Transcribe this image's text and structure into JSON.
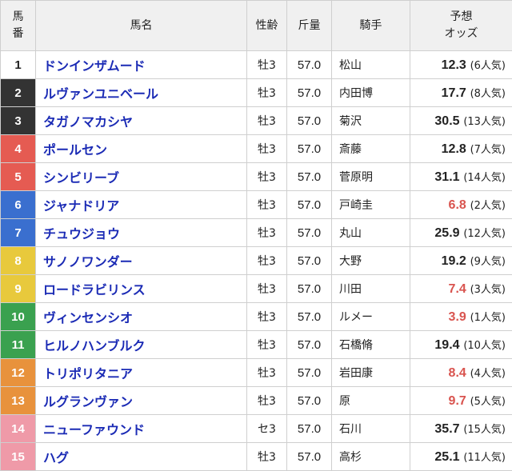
{
  "colors": {
    "header_bg": "#f0f0f0",
    "name_text": "#1b2bb5",
    "favorite_odds": "#d9544f"
  },
  "header": {
    "number": "馬\n番",
    "name": "馬名",
    "sex_age": "性齢",
    "weight": "斤量",
    "jockey": "騎手",
    "odds": "予想\nオッズ"
  },
  "rows": [
    {
      "num": "1",
      "name": "ドンインザムード",
      "sex_age": "牡3",
      "weight": "57.0",
      "jockey": "松山",
      "odds": "12.3",
      "pop": "(6人気)",
      "fav": false,
      "bg": "#ffffff",
      "fg": "#222222"
    },
    {
      "num": "2",
      "name": "ルヴァンユニベール",
      "sex_age": "牡3",
      "weight": "57.0",
      "jockey": "内田博",
      "odds": "17.7",
      "pop": "(8人気)",
      "fav": false,
      "bg": "#333333",
      "fg": "#ffffff"
    },
    {
      "num": "3",
      "name": "タガノマカシヤ",
      "sex_age": "牡3",
      "weight": "57.0",
      "jockey": "菊沢",
      "odds": "30.5",
      "pop": "(13人気)",
      "fav": false,
      "bg": "#333333",
      "fg": "#ffffff"
    },
    {
      "num": "4",
      "name": "ポールセン",
      "sex_age": "牡3",
      "weight": "57.0",
      "jockey": "斎藤",
      "odds": "12.8",
      "pop": "(7人気)",
      "fav": false,
      "bg": "#e55b52",
      "fg": "#ffffff"
    },
    {
      "num": "5",
      "name": "シンビリーブ",
      "sex_age": "牡3",
      "weight": "57.0",
      "jockey": "菅原明",
      "odds": "31.1",
      "pop": "(14人気)",
      "fav": false,
      "bg": "#e55b52",
      "fg": "#ffffff"
    },
    {
      "num": "6",
      "name": "ジャナドリア",
      "sex_age": "牡3",
      "weight": "57.0",
      "jockey": "戸崎圭",
      "odds": "6.8",
      "pop": "(2人気)",
      "fav": true,
      "bg": "#3a6fcf",
      "fg": "#ffffff"
    },
    {
      "num": "7",
      "name": "チュウジョウ",
      "sex_age": "牡3",
      "weight": "57.0",
      "jockey": "丸山",
      "odds": "25.9",
      "pop": "(12人気)",
      "fav": false,
      "bg": "#3a6fcf",
      "fg": "#ffffff"
    },
    {
      "num": "8",
      "name": "サノノワンダー",
      "sex_age": "牡3",
      "weight": "57.0",
      "jockey": "大野",
      "odds": "19.2",
      "pop": "(9人気)",
      "fav": false,
      "bg": "#e8c93c",
      "fg": "#ffffff"
    },
    {
      "num": "9",
      "name": "ロードラビリンス",
      "sex_age": "牡3",
      "weight": "57.0",
      "jockey": "川田",
      "odds": "7.4",
      "pop": "(3人気)",
      "fav": true,
      "bg": "#e8c93c",
      "fg": "#ffffff"
    },
    {
      "num": "10",
      "name": "ヴィンセンシオ",
      "sex_age": "牡3",
      "weight": "57.0",
      "jockey": "ルメー",
      "odds": "3.9",
      "pop": "(1人気)",
      "fav": true,
      "bg": "#3aa14f",
      "fg": "#ffffff"
    },
    {
      "num": "11",
      "name": "ヒルノハンブルク",
      "sex_age": "牡3",
      "weight": "57.0",
      "jockey": "石橋脩",
      "odds": "19.4",
      "pop": "(10人気)",
      "fav": false,
      "bg": "#3aa14f",
      "fg": "#ffffff"
    },
    {
      "num": "12",
      "name": "トリポリタニア",
      "sex_age": "牡3",
      "weight": "57.0",
      "jockey": "岩田康",
      "odds": "8.4",
      "pop": "(4人気)",
      "fav": true,
      "bg": "#e8923c",
      "fg": "#ffffff"
    },
    {
      "num": "13",
      "name": "ルグランヴァン",
      "sex_age": "牡3",
      "weight": "57.0",
      "jockey": "原",
      "odds": "9.7",
      "pop": "(5人気)",
      "fav": true,
      "bg": "#e8923c",
      "fg": "#ffffff"
    },
    {
      "num": "14",
      "name": "ニューファウンド",
      "sex_age": "セ3",
      "weight": "57.0",
      "jockey": "石川",
      "odds": "35.7",
      "pop": "(15人気)",
      "fav": false,
      "bg": "#ef9aa8",
      "fg": "#ffffff"
    },
    {
      "num": "15",
      "name": "ハグ",
      "sex_age": "牡3",
      "weight": "57.0",
      "jockey": "高杉",
      "odds": "25.1",
      "pop": "(11人気)",
      "fav": false,
      "bg": "#ef9aa8",
      "fg": "#ffffff"
    }
  ]
}
